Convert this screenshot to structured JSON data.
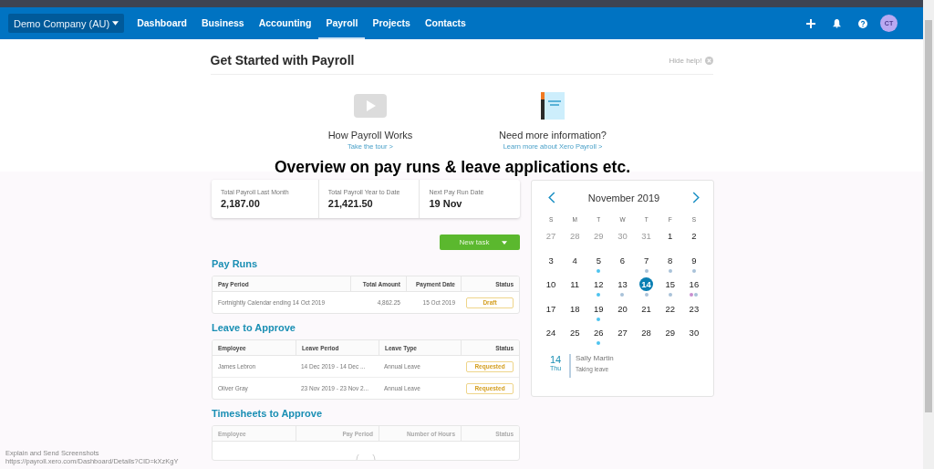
{
  "top_nav": {
    "org": "Demo Company (AU)",
    "avatar": "CT",
    "items": [
      {
        "label": "Dashboard",
        "selected": false
      },
      {
        "label": "Business",
        "selected": false
      },
      {
        "label": "Accounting",
        "selected": false
      },
      {
        "label": "Payroll",
        "selected": true
      },
      {
        "label": "Projects",
        "selected": false
      },
      {
        "label": "Contacts",
        "selected": false
      }
    ]
  },
  "help": {
    "title": "Get Started with Payroll",
    "hide": "Hide help!",
    "cards": [
      {
        "kind": "video",
        "title": "How Payroll Works",
        "link": "Take the tour >"
      },
      {
        "kind": "guide",
        "title": "Need more information?",
        "link": "Learn more about Xero Payroll >"
      }
    ]
  },
  "caption": "Overview on pay runs & leave applications etc.",
  "summary": [
    {
      "label": "Total Payroll Last Month",
      "value": "2,187.00"
    },
    {
      "label": "Total Payroll Year to Date",
      "value": "21,421.50"
    },
    {
      "label": "Next Pay Run Date",
      "value": "19 Nov"
    }
  ],
  "new_task": "New task",
  "sections": [
    {
      "title": "Pay Runs",
      "columns": [
        "Pay Period",
        "Total Amount",
        "Payment Date",
        "Status"
      ],
      "rows": [
        {
          "cells": [
            "Fortnightly Calendar ending 14 Oct 2019",
            "4,862.25",
            "15 Oct 2019"
          ],
          "status": "Draft"
        }
      ]
    },
    {
      "title": "Leave to Approve",
      "columns": [
        "Employee",
        "Leave Period",
        "Leave Type",
        "Status"
      ],
      "rows": [
        {
          "cells": [
            "James Lebron",
            "14 Dec 2019 - 14 Dec ...",
            "Annual Leave"
          ],
          "status": "Requested"
        },
        {
          "cells": [
            "Oliver Gray",
            "23 Nov 2019 - 23 Nov 2...",
            "Annual Leave"
          ],
          "status": "Requested"
        }
      ]
    },
    {
      "title": "Timesheets to Approve",
      "columns": [
        "Employee",
        "Pay Period",
        "Number of Hours",
        "Status"
      ]
    }
  ],
  "calendar": {
    "month": "November 2019",
    "weekdays": [
      "S",
      "M",
      "T",
      "W",
      "T",
      "F",
      "S"
    ],
    "days": [
      {
        "day": "27",
        "muted": true,
        "selected": false
      },
      {
        "day": "28",
        "muted": true,
        "selected": false
      },
      {
        "day": "29",
        "muted": true,
        "selected": false
      },
      {
        "day": "30",
        "muted": true,
        "selected": false
      },
      {
        "day": "31",
        "muted": true,
        "selected": false
      },
      {
        "day": "1",
        "muted": false,
        "selected": false
      },
      {
        "day": "2",
        "muted": false,
        "selected": false
      },
      {
        "day": "3",
        "muted": false,
        "selected": false
      },
      {
        "day": "4",
        "muted": false,
        "selected": false
      },
      {
        "day": "5",
        "muted": false,
        "selected": false,
        "dots": [
          {
            "color": "#4ec3ef"
          }
        ]
      },
      {
        "day": "6",
        "muted": false,
        "selected": false
      },
      {
        "day": "7",
        "muted": false,
        "selected": false,
        "dots": [
          {
            "color": "#a9c2d9"
          }
        ]
      },
      {
        "day": "8",
        "muted": false,
        "selected": false,
        "dots": [
          {
            "color": "#a9c2d9"
          }
        ]
      },
      {
        "day": "9",
        "muted": false,
        "selected": false,
        "dots": [
          {
            "color": "#a9c2d9"
          }
        ]
      },
      {
        "day": "10",
        "muted": false,
        "selected": false
      },
      {
        "day": "11",
        "muted": false,
        "selected": false
      },
      {
        "day": "12",
        "muted": false,
        "selected": false,
        "dots": [
          {
            "color": "#4ec3ef"
          }
        ]
      },
      {
        "day": "13",
        "muted": false,
        "selected": false,
        "dots": [
          {
            "color": "#a9c2d9"
          }
        ]
      },
      {
        "day": "14",
        "muted": false,
        "selected": true,
        "dots": [
          {
            "color": "#a9c2d9"
          }
        ]
      },
      {
        "day": "15",
        "muted": false,
        "selected": false,
        "dots": [
          {
            "color": "#a9c2d9"
          }
        ]
      },
      {
        "day": "16",
        "muted": false,
        "selected": false,
        "dots": [
          {
            "color": "#c98fd0"
          },
          {
            "color": "#a9c2d9"
          }
        ]
      },
      {
        "day": "17",
        "muted": false,
        "selected": false
      },
      {
        "day": "18",
        "muted": false,
        "selected": false
      },
      {
        "day": "19",
        "muted": false,
        "selected": false,
        "dots": [
          {
            "color": "#4ec3ef"
          }
        ]
      },
      {
        "day": "20",
        "muted": false,
        "selected": false
      },
      {
        "day": "21",
        "muted": false,
        "selected": false
      },
      {
        "day": "22",
        "muted": false,
        "selected": false
      },
      {
        "day": "23",
        "muted": false,
        "selected": false
      },
      {
        "day": "24",
        "muted": false,
        "selected": false
      },
      {
        "day": "25",
        "muted": false,
        "selected": false
      },
      {
        "day": "26",
        "muted": false,
        "selected": false,
        "dots": [
          {
            "color": "#4ec3ef"
          }
        ]
      },
      {
        "day": "27",
        "muted": false,
        "selected": false
      },
      {
        "day": "28",
        "muted": false,
        "selected": false
      },
      {
        "day": "29",
        "muted": false,
        "selected": false
      },
      {
        "day": "30",
        "muted": false,
        "selected": false
      }
    ],
    "event": {
      "day": "14",
      "weekday": "Thu",
      "name": "Sally Martin",
      "note": "Taking leave"
    }
  },
  "footer_note": {
    "title": "Explain and Send Screenshots",
    "url": "https://payroll.xero.com/Dashboard/Details?CID=kXzKgY"
  }
}
